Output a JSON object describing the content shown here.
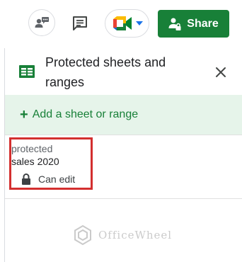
{
  "toolbar": {
    "avatar_icon": "person-comment-icon",
    "comment_icon": "comment-icon",
    "meet_icon": "google-meet-icon",
    "meet_dropdown_icon": "caret-down-icon",
    "share_icon": "lock-person-icon",
    "share_label": "Share",
    "share_color": "#188038"
  },
  "panel": {
    "icon": "sheets-grid-icon",
    "title": "Protected sheets and ranges",
    "close_icon": "close-icon",
    "add_label": "Add a sheet or range",
    "add_icon": "plus-icon",
    "add_background": "#e6f4ea",
    "accent_color": "#188038",
    "items": [
      {
        "description": "protected",
        "range": "sales 2020",
        "permission": "Can edit",
        "permission_icon": "lock-icon",
        "highlight_color": "#d32f2f"
      }
    ]
  },
  "watermark": {
    "text": "OfficeWheel"
  }
}
